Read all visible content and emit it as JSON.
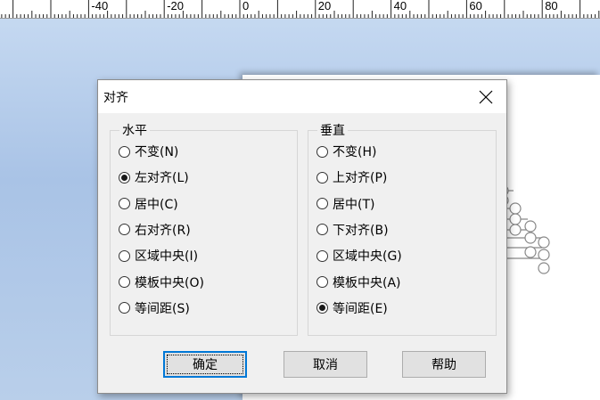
{
  "ruler": {
    "labels": [
      "-40",
      "-20",
      "0",
      "20",
      "40",
      "60",
      "80"
    ]
  },
  "dialog": {
    "title": "对齐",
    "horizontal": {
      "legend": "水平",
      "options": [
        {
          "label": "不变(N)",
          "checked": false
        },
        {
          "label": "左对齐(L)",
          "checked": true
        },
        {
          "label": "居中(C)",
          "checked": false
        },
        {
          "label": "右对齐(R)",
          "checked": false
        },
        {
          "label": "区域中央(I)",
          "checked": false
        },
        {
          "label": "模板中央(O)",
          "checked": false
        },
        {
          "label": "等间距(S)",
          "checked": false
        }
      ]
    },
    "vertical": {
      "legend": "垂直",
      "options": [
        {
          "label": "不变(H)",
          "checked": false
        },
        {
          "label": "上对齐(P)",
          "checked": false
        },
        {
          "label": "居中(T)",
          "checked": false
        },
        {
          "label": "下对齐(B)",
          "checked": false
        },
        {
          "label": "区域中央(G)",
          "checked": false
        },
        {
          "label": "模板中央(A)",
          "checked": false
        },
        {
          "label": "等间距(E)",
          "checked": true
        }
      ]
    },
    "buttons": {
      "ok": "确定",
      "cancel": "取消",
      "help": "帮助"
    }
  }
}
